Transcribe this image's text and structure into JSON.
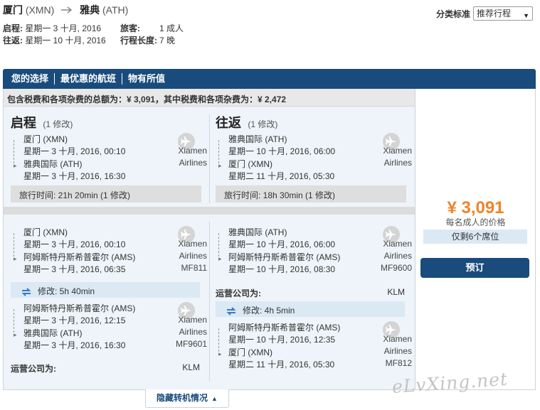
{
  "header": {
    "origin_city": "厦门",
    "origin_code": "(XMN)",
    "dest_city": "雅典",
    "dest_code": "(ATH)",
    "depart_label": "启程:",
    "depart_value": "星期一 3 十月, 2016",
    "return_label": "往返:",
    "return_value": "星期一 10 十月, 2016",
    "travelers_label": "旅客:",
    "travelers_value": "1 成人",
    "length_label": "行程长度:",
    "length_value": "7 晚"
  },
  "sort": {
    "label": "分类标准",
    "selected": "推荐行程"
  },
  "tabs": [
    "您的选择",
    "最优惠的航班",
    "物有所值"
  ],
  "total_text": "包含税费和各项杂费的总额为：¥ 3,091，其中税费和各项杂费为：¥ 2,472",
  "summary": {
    "outbound": {
      "title": "启程",
      "stops": "(1 修改)",
      "leg": {
        "from": "厦门 (XMN)",
        "depart": "星期一 3 十月, 2016, 00:10",
        "to": "雅典国际 (ATH)",
        "arrive": "星期一 3 十月, 2016, 16:30",
        "airline_line1": "Xiamen",
        "airline_line2": "Airlines"
      },
      "travel_time": "旅行时间:  21h 20min (1 修改)"
    },
    "inbound": {
      "title": "往返",
      "stops": "(1 修改)",
      "leg": {
        "from": "雅典国际 (ATH)",
        "depart": "星期一 10 十月, 2016, 06:00",
        "to": "厦门 (XMN)",
        "arrive": "星期二 11 十月, 2016, 05:30",
        "airline_line1": "Xiamen",
        "airline_line2": "Airlines"
      },
      "travel_time": "旅行时间:  18h 30min (1 修改)"
    }
  },
  "detail": {
    "outbound": {
      "leg1": {
        "from": "厦门 (XMN)",
        "depart": "星期一 3 十月, 2016, 00:10",
        "to": "阿姆斯特丹斯希普霍尔 (AMS)",
        "arrive": "星期一 3 十月, 2016, 06:35",
        "airline_line1": "Xiamen",
        "airline_line2": "Airlines",
        "flight_no": "MF811"
      },
      "layover": "修改:  5h 40min",
      "leg2": {
        "from": "阿姆斯特丹斯希普霍尔 (AMS)",
        "depart": "星期一 3 十月, 2016, 12:15",
        "to": "雅典国际 (ATH)",
        "arrive": "星期一 3 十月, 2016, 16:30",
        "airline_line1": "Xiamen",
        "airline_line2": "Airlines",
        "flight_no": "MF9601"
      },
      "operator_label": "运营公司为:",
      "operator_value": "KLM"
    },
    "inbound": {
      "leg1": {
        "from": "雅典国际 (ATH)",
        "depart": "星期一 10 十月, 2016, 06:00",
        "to": "阿姆斯特丹斯希普霍尔 (AMS)",
        "arrive": "星期一 10 十月, 2016, 08:30",
        "airline_line1": "Xiamen",
        "airline_line2": "Airlines",
        "flight_no": "MF9600"
      },
      "operator_label": "运营公司为:",
      "operator_value": "KLM",
      "layover": "修改:  4h 5min",
      "leg2": {
        "from": "阿姆斯特丹斯希普霍尔 (AMS)",
        "depart": "星期一 10 十月, 2016, 12:35",
        "to": "厦门 (XMN)",
        "arrive": "星期二 11 十月, 2016, 05:30",
        "airline_line1": "Xiamen",
        "airline_line2": "Airlines",
        "flight_no": "MF812"
      }
    }
  },
  "price": {
    "amount": "¥ 3,091",
    "per_person": "每名成人的价格",
    "seats_left": "仅剩6个席位",
    "book_label": "预订"
  },
  "toggle_label": "隐藏转机情况",
  "watermark": "eLvXing.net",
  "icons": {
    "route_arrow": "arrow-right-icon",
    "plane": "airplane-icon",
    "layover": "swap-arrows-icon",
    "caret": "caret-down-icon",
    "toggle": "triangle-up-icon"
  },
  "colors": {
    "brand": "#194b7c",
    "price": "#f0832a",
    "layover_bg": "#dbe9f5",
    "card_bg": "#eef4f9"
  }
}
